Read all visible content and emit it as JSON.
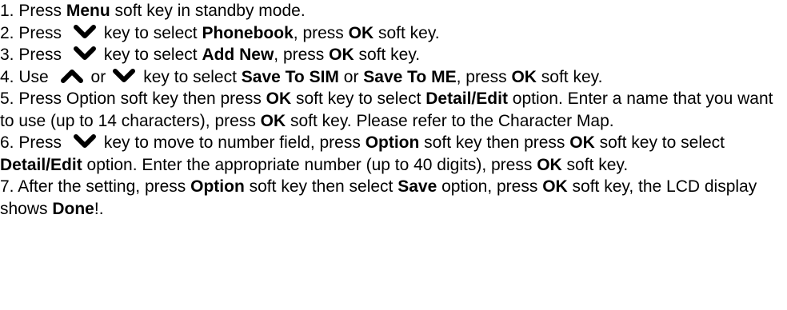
{
  "steps": [
    {
      "n": "1. Press ",
      "b1": "Menu",
      "t1": " soft key in standby mode."
    },
    {
      "n": "2. Press ",
      "t1": "key to select ",
      "b1": "Phonebook",
      "t2": ", press ",
      "b2": "OK",
      "t3": " soft key."
    },
    {
      "n": "3. Press ",
      "t1": "key to select ",
      "b1": "Add New",
      "t2": ", press ",
      "b2": "OK",
      "t3": " soft key."
    },
    {
      "n": "4. Use ",
      "or": "or",
      "t1": "key to select ",
      "b1": "Save To SIM",
      "t2": " or ",
      "b2": "Save To ME",
      "t3": ", press ",
      "b3": "OK",
      "t4": " soft key."
    },
    {
      "n": "5. Press Option soft key then press ",
      "b1": "OK",
      "t1": " soft key to select ",
      "b2": "Detail/Edit",
      "t2": " option. Enter a name that you want to use (up to 14 characters), press ",
      "b3": "OK",
      "t3": " soft key. Please refer to the Character Map."
    },
    {
      "n": "6. Press ",
      "t1": "key to move to number field, press ",
      "b1": "Option",
      "t2": " soft key then press ",
      "b2": "OK",
      "t3": " soft key to select ",
      "b3": "Detail/Edit",
      "t4": " option. Enter the appropriate number (up to 40 digits), press ",
      "b4": "OK",
      "t5": " soft key."
    },
    {
      "n": "7. After the setting, press ",
      "b1": "Option",
      "t1": " soft key then select ",
      "b2": "Save",
      "t2": " option, press ",
      "b3": "OK",
      "t3": " soft key, the LCD display shows ",
      "b4": "Done",
      "t4": "!."
    }
  ],
  "icons": {
    "down": "chevron-down-icon",
    "up": "chevron-up-icon"
  }
}
